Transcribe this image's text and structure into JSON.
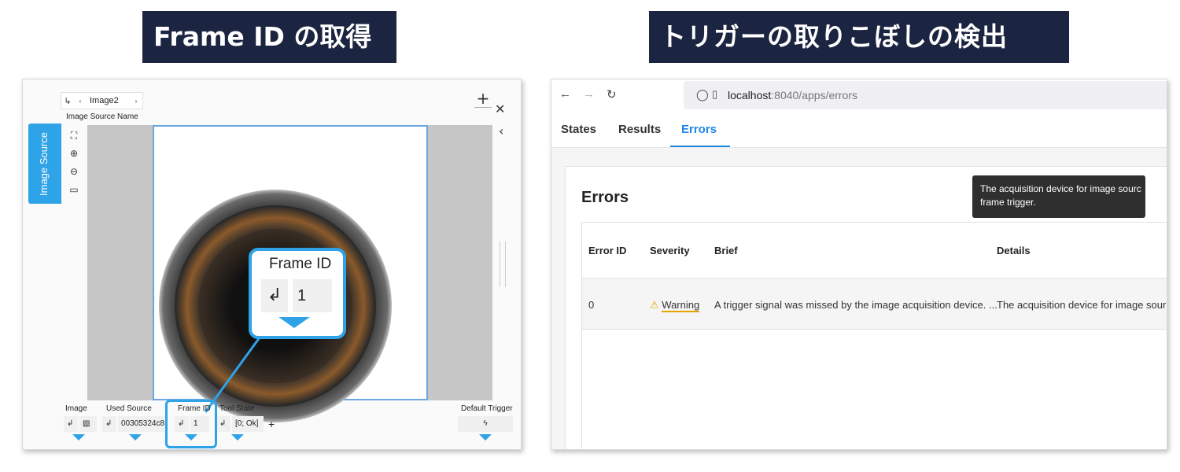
{
  "headings": {
    "left": "Frame ID の取得",
    "right": "トリガーの取りこぼしの検出"
  },
  "left_app": {
    "side_tab": "Image Source",
    "toolbar_label": "Image2",
    "image_source_name": "Image Source Name",
    "callout": {
      "title": "Frame ID",
      "value": "1",
      "icon": "↲"
    },
    "bottom": {
      "image_label": "Image",
      "used_source_label": "Used Source",
      "used_source_value": "00305324c8",
      "frame_id_label": "Frame ID",
      "frame_id_value": "1",
      "tool_state_label": "Tool State",
      "tool_state_value": "[0; Ok]",
      "default_trigger_label": "Default Trigger",
      "add": "+"
    }
  },
  "browser": {
    "url_host": "localhost",
    "url_path": ":8040/apps/errors",
    "tabs": [
      "States",
      "Results",
      "Errors"
    ],
    "card_title": "Errors",
    "columns": [
      "Error ID",
      "Severity",
      "Brief",
      "Details"
    ],
    "row": {
      "id": "0",
      "severity": "Warning",
      "brief": "A trigger signal was missed by the image acquisition device. ...",
      "details": "The acquisition device for image source"
    },
    "tooltip": [
      "The acquisition device for image sourc",
      "frame trigger."
    ]
  },
  "colors": {
    "accent": "#2ea3e8",
    "heading_bg": "#1b2440",
    "link": "#1e88e5",
    "warning": "#e5a400"
  }
}
